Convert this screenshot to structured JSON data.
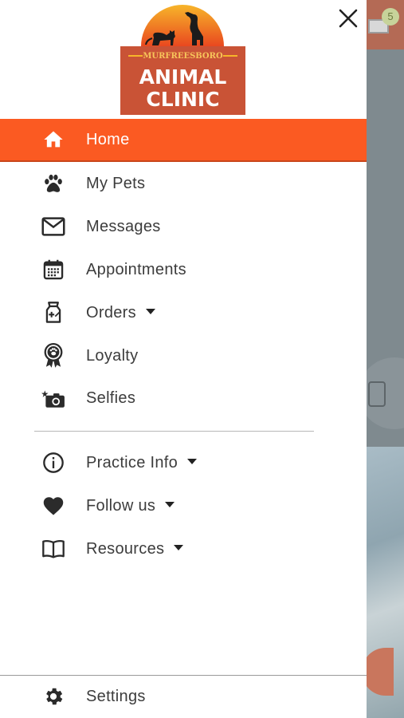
{
  "logo": {
    "top_text": "MURFREESBORO",
    "line1": "ANIMAL",
    "line2": "CLINIC",
    "colors": {
      "sun": "#f49a1c",
      "box": "#c95336",
      "silhouette": "#1b1b1b"
    }
  },
  "close_icon": "close-icon",
  "nav": {
    "main": [
      {
        "label": "Home",
        "icon": "home-icon",
        "active": true,
        "dropdown": false
      },
      {
        "label": "My Pets",
        "icon": "paw-icon",
        "active": false,
        "dropdown": false
      },
      {
        "label": "Messages",
        "icon": "mail-icon",
        "active": false,
        "dropdown": false
      },
      {
        "label": "Appointments",
        "icon": "calendar-icon",
        "active": false,
        "dropdown": false
      },
      {
        "label": "Orders",
        "icon": "medicine-bag-icon",
        "active": false,
        "dropdown": true
      },
      {
        "label": "Loyalty",
        "icon": "award-ribbon-icon",
        "active": false,
        "dropdown": false
      },
      {
        "label": "Selfies",
        "icon": "camera-icon",
        "active": false,
        "dropdown": false
      }
    ],
    "secondary": [
      {
        "label": "Practice Info",
        "icon": "info-icon",
        "dropdown": true
      },
      {
        "label": "Follow us",
        "icon": "heart-icon",
        "dropdown": true
      },
      {
        "label": "Resources",
        "icon": "book-icon",
        "dropdown": true
      }
    ],
    "settings": {
      "label": "Settings",
      "icon": "gear-icon"
    }
  },
  "background": {
    "message_badge": "5"
  },
  "colors": {
    "accent": "#fb5a22",
    "text": "#3c3c3c",
    "icon": "#2b2b2b"
  }
}
